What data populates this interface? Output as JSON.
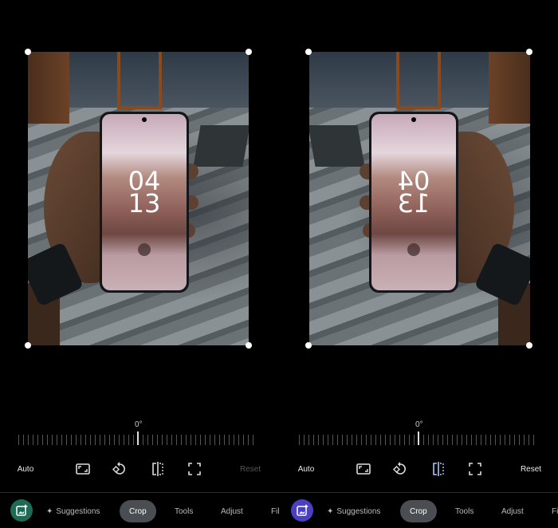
{
  "panels": [
    {
      "phone_clock": {
        "hours": "04",
        "minutes": "13"
      },
      "straighten_angle": "0°",
      "toolbar": {
        "auto_label": "Auto",
        "reset_label": "Reset",
        "reset_enabled": false,
        "flip_active": false
      },
      "nav": {
        "suggestions": "Suggestions",
        "crop": "Crop",
        "tools": "Tools",
        "adjust": "Adjust",
        "filters": "Fil",
        "active": "Crop"
      },
      "app_icon_color": "#1e6b55"
    },
    {
      "phone_clock": {
        "hours": "04",
        "minutes": "13"
      },
      "straighten_angle": "0°",
      "toolbar": {
        "auto_label": "Auto",
        "reset_label": "Reset",
        "reset_enabled": true,
        "flip_active": true
      },
      "nav": {
        "suggestions": "Suggestions",
        "crop": "Crop",
        "tools": "Tools",
        "adjust": "Adjust",
        "filters": "Fi",
        "active": "Crop"
      },
      "app_icon_color": "#4b3fc4"
    }
  ],
  "colors": {
    "background": "#000000",
    "active_pill": "#4a4d52",
    "flip_active": "#a8c7fa"
  }
}
